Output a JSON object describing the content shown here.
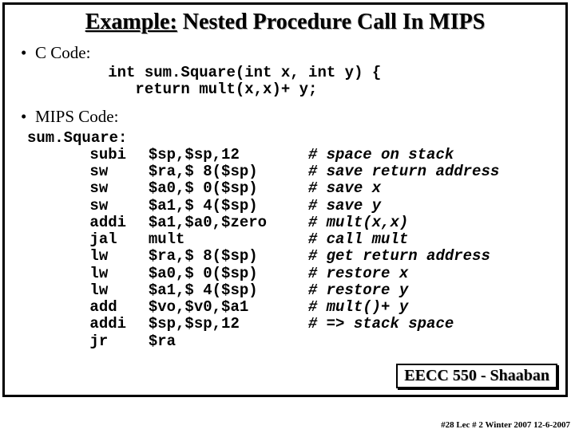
{
  "title_prefix": "Example:",
  "title_rest": "  Nested Procedure Call In MIPS",
  "section_c": "C Code:",
  "c_code_line1": "int sum.Square(int x, int y) {",
  "c_code_line2": "   return mult(x,x)+ y;",
  "section_mips": "MIPS Code:",
  "mips_label": "sum.Square:",
  "mips": [
    {
      "op": "subi",
      "args": "$sp,$sp,12",
      "cmt": "# space on stack"
    },
    {
      "op": "sw",
      "args": "$ra,$ 8($sp)",
      "cmt": "# save return address"
    },
    {
      "op": "sw",
      "args": "$a0,$ 0($sp)",
      "cmt": "# save x"
    },
    {
      "op": "sw",
      "args": "$a1,$ 4($sp)",
      "cmt": "# save y"
    },
    {
      "op": "addi",
      "args": "$a1,$a0,$zero",
      "cmt": "# mult(x,x)"
    },
    {
      "op": "jal",
      "args": "mult",
      "cmt": "# call mult"
    },
    {
      "op": "lw",
      "args": "$ra,$ 8($sp)",
      "cmt": "# get return address"
    },
    {
      "op": "lw",
      "args": "$a0,$ 0($sp)",
      "cmt": "# restore x"
    },
    {
      "op": "lw",
      "args": "$a1,$ 4($sp)",
      "cmt": "# restore y"
    },
    {
      "op": "add",
      "args": "$vo,$v0,$a1",
      "cmt": "# mult()+ y"
    },
    {
      "op": "addi",
      "args": "$sp,$sp,12",
      "cmt": "# => stack space"
    },
    {
      "op": "jr",
      "args": "$ra",
      "cmt": ""
    }
  ],
  "footer_box": "EECC 550 - Shaaban",
  "footer_line": "#28  Lec # 2  Winter 2007  12-6-2007"
}
